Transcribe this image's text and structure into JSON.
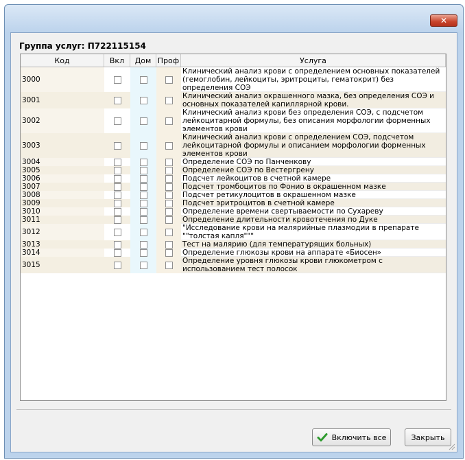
{
  "window": {
    "close_label": "✕"
  },
  "group": {
    "label": "Группа услуг: П722115154"
  },
  "table": {
    "columns": [
      "Код",
      "Вкл",
      "Дом",
      "Проф",
      "Услуга"
    ],
    "rows": [
      {
        "code": "3000",
        "service": "Клинический анализ крови с определением основных показателей (гемоглобин, лейкоциты, эритроциты, гематокрит) без определения СОЭ",
        "vkl": false,
        "dom": false,
        "prof": false
      },
      {
        "code": "3001",
        "service": "Клинический анализ окрашенного мазка, без определения СОЭ и основных показателей капиллярной крови.",
        "vkl": false,
        "dom": false,
        "prof": false
      },
      {
        "code": "3002",
        "service": "Клинический анализ крови без определения СОЭ, с подсчетом лейкоцитарной формулы, без описания морфологии форменных элементов крови",
        "vkl": false,
        "dom": false,
        "prof": false
      },
      {
        "code": "3003",
        "service": "Клинический анализ крови с определением СОЭ, подсчетом лейкоцитарной формулы и описанием морфологии форменных элементов крови",
        "vkl": false,
        "dom": false,
        "prof": false
      },
      {
        "code": "3004",
        "service": "Определение СОЭ по Панченкову",
        "vkl": false,
        "dom": false,
        "prof": false
      },
      {
        "code": "3005",
        "service": "Определение СОЭ по Вестергрену",
        "vkl": false,
        "dom": false,
        "prof": false
      },
      {
        "code": "3006",
        "service": "Подсчет лейкоцитов в счетной камере",
        "vkl": false,
        "dom": false,
        "prof": false
      },
      {
        "code": "3007",
        "service": "Подсчет тромбоцитов по Фонио в окрашенном мазке",
        "vkl": false,
        "dom": false,
        "prof": false
      },
      {
        "code": "3008",
        "service": "Подсчет ретикулоцитов в окрашенном мазке",
        "vkl": false,
        "dom": false,
        "prof": false
      },
      {
        "code": "3009",
        "service": "Подсчет эритроцитов в счетной камере",
        "vkl": false,
        "dom": false,
        "prof": false
      },
      {
        "code": "3010",
        "service": "Определение времени свертываемости по Сухареву",
        "vkl": false,
        "dom": false,
        "prof": false
      },
      {
        "code": "3011",
        "service": "Определение длительности кровотечения по Дуке",
        "vkl": false,
        "dom": false,
        "prof": false
      },
      {
        "code": "3012",
        "service": "\"Исследование крови на малярийные плазмодии в препарате \"\"толстая капля\"\"\"",
        "vkl": false,
        "dom": false,
        "prof": false
      },
      {
        "code": "3013",
        "service": "Тест на малярию (для температурящих больных)",
        "vkl": false,
        "dom": false,
        "prof": false
      },
      {
        "code": "3014",
        "service": "Определение глюкозы крови на аппарате «Биосен»",
        "vkl": false,
        "dom": false,
        "prof": false
      },
      {
        "code": "3015",
        "service": "Определение уровня глюкозы крови глюкометром с использованием тест полосок",
        "vkl": false,
        "dom": false,
        "prof": false
      }
    ]
  },
  "buttons": {
    "include_all": "Включить все",
    "close": "Закрыть"
  },
  "icons": {
    "include_all_icon": "check-icon",
    "close_icon": "close-icon"
  }
}
